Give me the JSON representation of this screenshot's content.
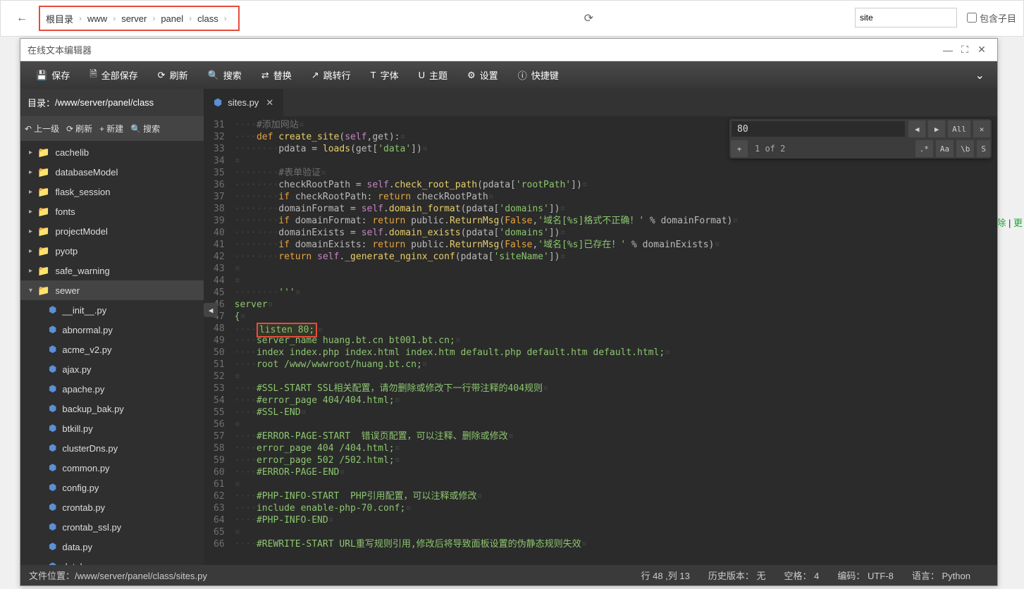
{
  "breadcrumb": [
    "根目录",
    "www",
    "server",
    "panel",
    "class"
  ],
  "topSearch": {
    "value": "site",
    "checkboxLabel": "包含子目"
  },
  "window": {
    "title": "在线文本编辑器",
    "toolbar": [
      {
        "icon": "💾",
        "label": "保存"
      },
      {
        "icon": "🗎",
        "label": "全部保存"
      },
      {
        "icon": "⟳",
        "label": "刷新"
      },
      {
        "icon": "🔍",
        "label": "搜索"
      },
      {
        "icon": "⇄",
        "label": "替换"
      },
      {
        "icon": "↗",
        "label": "跳转行"
      },
      {
        "icon": "T",
        "label": "字体"
      },
      {
        "icon": "U",
        "label": "主题"
      },
      {
        "icon": "⚙",
        "label": "设置"
      },
      {
        "icon": "ⓘ",
        "label": "快捷键"
      }
    ]
  },
  "sidebar": {
    "pathLabel": "目录：",
    "path": "/www/server/panel/class",
    "actions": [
      {
        "icon": "↶",
        "label": "上一级"
      },
      {
        "icon": "⟳",
        "label": "刷新"
      },
      {
        "icon": "+",
        "label": "新建"
      },
      {
        "icon": "🔍",
        "label": "搜索"
      }
    ],
    "folders": [
      "cachelib",
      "databaseModel",
      "flask_session",
      "fonts",
      "projectModel",
      "pyotp",
      "safe_warning",
      "sewer"
    ],
    "files": [
      "__init__.py",
      "abnormal.py",
      "acme_v2.py",
      "ajax.py",
      "apache.py",
      "backup_bak.py",
      "btkill.py",
      "clusterDns.py",
      "common.py",
      "config.py",
      "crontab.py",
      "crontab_ssl.py",
      "data.py",
      "database.py"
    ]
  },
  "tab": {
    "filename": "sites.py"
  },
  "editor": {
    "startLine": 31,
    "lines": [
      {
        "n": 31,
        "t": "comment",
        "txt": "····#添加网站"
      },
      {
        "n": 32,
        "t": "code",
        "html": "····<span class='kw'>def</span> <span class='fn'>create_site</span>(<span class='self'>self</span>,get):"
      },
      {
        "n": 33,
        "t": "code",
        "html": "········pdata <span class='op'>=</span> <span class='fn'>loads</span>(get[<span class='str'>'data'</span>])"
      },
      {
        "n": 34,
        "t": "blank",
        "txt": ""
      },
      {
        "n": 35,
        "t": "comment",
        "txt": "········#表单验证"
      },
      {
        "n": 36,
        "t": "code",
        "html": "········checkRootPath <span class='op'>=</span> <span class='self'>self</span>.<span class='fn'>check_root_path</span>(pdata[<span class='str'>'rootPath'</span>])"
      },
      {
        "n": 37,
        "t": "code",
        "html": "········<span class='kw'>if</span> checkRootPath: <span class='kw'>return</span> checkRootPath"
      },
      {
        "n": 38,
        "t": "code",
        "html": "········domainFormat <span class='op'>=</span> <span class='self'>self</span>.<span class='fn'>domain_format</span>(pdata[<span class='str'>'domains'</span>])"
      },
      {
        "n": 39,
        "t": "code",
        "html": "········<span class='kw'>if</span> domainFormat: <span class='kw'>return</span> public.<span class='fn'>ReturnMsg</span>(<span class='bool'>False</span>,<span class='str'>'域名[%s]格式不正确！'</span> <span class='op'>%</span> domainFormat)"
      },
      {
        "n": 40,
        "t": "code",
        "html": "········domainExists <span class='op'>=</span> <span class='self'>self</span>.<span class='fn'>domain_exists</span>(pdata[<span class='str'>'domains'</span>])"
      },
      {
        "n": 41,
        "t": "code",
        "html": "········<span class='kw'>if</span> domainExists: <span class='kw'>return</span> public.<span class='fn'>ReturnMsg</span>(<span class='bool'>False</span>,<span class='str'>'域名[%s]已存在！'</span> <span class='op'>%</span> domainExists)"
      },
      {
        "n": 42,
        "t": "code",
        "html": "········<span class='kw'>return</span> <span class='self'>self</span>.<span class='fn'>_generate_nginx_conf</span>(pdata[<span class='str'>'siteName'</span>])"
      },
      {
        "n": 43,
        "t": "blank",
        "txt": ""
      },
      {
        "n": 44,
        "t": "blank",
        "txt": ""
      },
      {
        "n": 45,
        "t": "code",
        "html": "········<span class='str'>'''</span>"
      },
      {
        "n": 46,
        "t": "code",
        "html": "<span class='str'>server</span>"
      },
      {
        "n": 47,
        "t": "code",
        "html": "<span class='str'>{</span>"
      },
      {
        "n": 48,
        "t": "highlight",
        "html": "<span class='str'>····</span><span class='highlight-box'><span class='str'>listen 80;</span></span>"
      },
      {
        "n": 49,
        "t": "code",
        "html": "<span class='str'>····server_name huang.bt.cn bt001.bt.cn;</span>"
      },
      {
        "n": 50,
        "t": "code",
        "html": "<span class='str'>····index index.php index.html index.htm default.php default.htm default.html;</span>"
      },
      {
        "n": 51,
        "t": "code",
        "html": "<span class='str'>····root /www/wwwroot/huang.bt.cn;</span>"
      },
      {
        "n": 52,
        "t": "blank",
        "txt": ""
      },
      {
        "n": 53,
        "t": "code",
        "html": "<span class='str'>····#SSL-START SSL相关配置，请勿删除或修改下一行带注释的404规则</span>"
      },
      {
        "n": 54,
        "t": "code",
        "html": "<span class='str'>····#error_page 404/404.html;</span>"
      },
      {
        "n": 55,
        "t": "code",
        "html": "<span class='str'>····#SSL-END</span>"
      },
      {
        "n": 56,
        "t": "blank",
        "txt": ""
      },
      {
        "n": 57,
        "t": "code",
        "html": "<span class='str'>····#ERROR-PAGE-START  错误页配置，可以注释、删除或修改</span>"
      },
      {
        "n": 58,
        "t": "code",
        "html": "<span class='str'>····error_page 404 /404.html;</span>"
      },
      {
        "n": 59,
        "t": "code",
        "html": "<span class='str'>····error_page 502 /502.html;</span>"
      },
      {
        "n": 60,
        "t": "code",
        "html": "<span class='str'>····#ERROR-PAGE-END</span>"
      },
      {
        "n": 61,
        "t": "blank",
        "txt": ""
      },
      {
        "n": 62,
        "t": "code",
        "html": "<span class='str'>····#PHP-INFO-START  PHP引用配置，可以注释或修改</span>"
      },
      {
        "n": 63,
        "t": "code",
        "html": "<span class='str'>····include enable-php-70.conf;</span>"
      },
      {
        "n": 64,
        "t": "code",
        "html": "<span class='str'>····#PHP-INFO-END</span>"
      },
      {
        "n": 65,
        "t": "blank",
        "txt": ""
      },
      {
        "n": 66,
        "t": "code",
        "html": "<span class='str'>····#REWRITE-START URL重写规则引用,修改后将导致面板设置的伪静态规则失效</span>"
      }
    ]
  },
  "search": {
    "value": "80",
    "count": "1 of 2",
    "allLabel": "All",
    "regexLabel": ".*",
    "caseLabel": "Aa",
    "wordLabel": "\\b",
    "selLabel": "S",
    "plusLabel": "+"
  },
  "status": {
    "fileLabel": "文件位置：",
    "filePath": "/www/server/panel/class/sites.py",
    "cursor": "行 48 ,列 13",
    "historyLabel": "历史版本：",
    "historyVal": "无",
    "spacesLabel": "空格：",
    "spacesVal": "4",
    "encodingLabel": "编码：",
    "encodingVal": "UTF-8",
    "langLabel": "语言：",
    "langVal": "Python"
  },
  "rightLinks": {
    "delete": "删除",
    "sep": " | ",
    "more": "更"
  }
}
